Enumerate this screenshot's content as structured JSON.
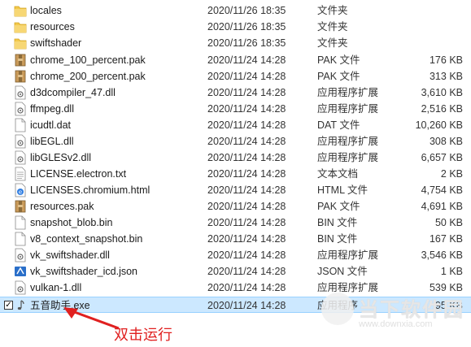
{
  "files": [
    {
      "name": "locales",
      "date": "2020/11/26 18:35",
      "type": "文件夹",
      "size": "",
      "icon": "folder-icon"
    },
    {
      "name": "resources",
      "date": "2020/11/26 18:35",
      "type": "文件夹",
      "size": "",
      "icon": "folder-icon"
    },
    {
      "name": "swiftshader",
      "date": "2020/11/26 18:35",
      "type": "文件夹",
      "size": "",
      "icon": "folder-icon"
    },
    {
      "name": "chrome_100_percent.pak",
      "date": "2020/11/24 14:28",
      "type": "PAK 文件",
      "size": "176 KB",
      "icon": "pak-file-icon"
    },
    {
      "name": "chrome_200_percent.pak",
      "date": "2020/11/24 14:28",
      "type": "PAK 文件",
      "size": "313 KB",
      "icon": "pak-file-icon"
    },
    {
      "name": "d3dcompiler_47.dll",
      "date": "2020/11/24 14:28",
      "type": "应用程序扩展",
      "size": "3,610 KB",
      "icon": "dll-file-icon"
    },
    {
      "name": "ffmpeg.dll",
      "date": "2020/11/24 14:28",
      "type": "应用程序扩展",
      "size": "2,516 KB",
      "icon": "dll-file-icon"
    },
    {
      "name": "icudtl.dat",
      "date": "2020/11/24 14:28",
      "type": "DAT 文件",
      "size": "10,260 KB",
      "icon": "blank-file-icon"
    },
    {
      "name": "libEGL.dll",
      "date": "2020/11/24 14:28",
      "type": "应用程序扩展",
      "size": "308 KB",
      "icon": "dll-file-icon"
    },
    {
      "name": "libGLESv2.dll",
      "date": "2020/11/24 14:28",
      "type": "应用程序扩展",
      "size": "6,657 KB",
      "icon": "dll-file-icon"
    },
    {
      "name": "LICENSE.electron.txt",
      "date": "2020/11/24 14:28",
      "type": "文本文档",
      "size": "2 KB",
      "icon": "text-file-icon"
    },
    {
      "name": "LICENSES.chromium.html",
      "date": "2020/11/24 14:28",
      "type": "HTML 文件",
      "size": "4,754 KB",
      "icon": "html-file-icon"
    },
    {
      "name": "resources.pak",
      "date": "2020/11/24 14:28",
      "type": "PAK 文件",
      "size": "4,691 KB",
      "icon": "pak-file-icon"
    },
    {
      "name": "snapshot_blob.bin",
      "date": "2020/11/24 14:28",
      "type": "BIN 文件",
      "size": "50 KB",
      "icon": "blank-file-icon"
    },
    {
      "name": "v8_context_snapshot.bin",
      "date": "2020/11/24 14:28",
      "type": "BIN 文件",
      "size": "167 KB",
      "icon": "blank-file-icon"
    },
    {
      "name": "vk_swiftshader.dll",
      "date": "2020/11/24 14:28",
      "type": "应用程序扩展",
      "size": "3,546 KB",
      "icon": "dll-file-icon"
    },
    {
      "name": "vk_swiftshader_icd.json",
      "date": "2020/11/24 14:28",
      "type": "JSON 文件",
      "size": "1 KB",
      "icon": "json-file-icon"
    },
    {
      "name": "vulkan-1.dll",
      "date": "2020/11/24 14:28",
      "type": "应用程序扩展",
      "size": "539 KB",
      "icon": "dll-file-icon"
    },
    {
      "name": "五音助手.exe",
      "date": "2020/11/24 14:28",
      "type": "应用程序",
      "size": "95 KB",
      "icon": "music-note-icon",
      "selected": true
    }
  ],
  "annotation": "双击运行",
  "watermark": {
    "text": "当下软件园",
    "url": "www.downxia.com"
  },
  "colors": {
    "selected_bg": "#cce8ff",
    "annotation": "#e02020",
    "folder": "#f2c94c"
  }
}
